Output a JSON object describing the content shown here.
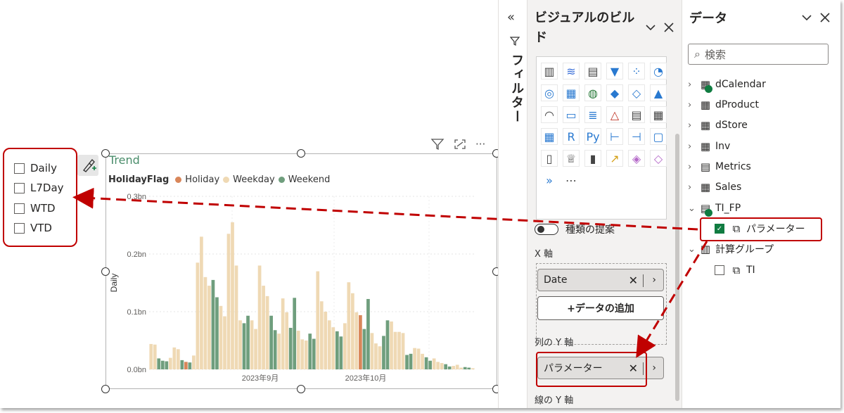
{
  "slicer": {
    "items": [
      {
        "label": "Daily",
        "checked": false
      },
      {
        "label": "L7Day",
        "checked": false
      },
      {
        "label": "WTD",
        "checked": false
      },
      {
        "label": "VTD",
        "checked": false
      }
    ]
  },
  "visual_header": {
    "filter_icon": "funnel-icon",
    "focus_icon": "expand-icon",
    "more_label": "···"
  },
  "chart_data": {
    "type": "bar",
    "title": "Trend",
    "legend_title": "HolidayFlag",
    "legend_position": "top-left",
    "series": [
      {
        "name": "Holiday",
        "color": "#d9865a"
      },
      {
        "name": "Weekday",
        "color": "#efd9b4"
      },
      {
        "name": "Weekend",
        "color": "#6f9e7d"
      }
    ],
    "ylabel": "Daily",
    "xlabel": "",
    "yticks": [
      "0.3bn",
      "0.2bn",
      "0.1bn",
      "0.0bn"
    ],
    "ylim": [
      0,
      0.3
    ],
    "xticks": [
      "2023年9月",
      "2023年10月"
    ],
    "grid": true,
    "values": [
      0.044,
      0.043,
      0.019,
      0.015,
      0.014,
      0.02,
      0.038,
      0.035,
      0.016,
      0.013,
      0.012,
      0.024,
      0.185,
      0.23,
      0.16,
      0.145,
      0.155,
      0.125,
      0.11,
      0.092,
      0.235,
      0.255,
      0.18,
      0.085,
      0.08,
      0.093,
      0.085,
      0.07,
      0.18,
      0.145,
      0.127,
      0.093,
      0.068,
      0.062,
      0.123,
      0.099,
      0.072,
      0.124,
      0.067,
      0.052,
      0.05,
      0.062,
      0.053,
      0.17,
      0.118,
      0.1,
      0.085,
      0.073,
      0.066,
      0.057,
      0.08,
      0.151,
      0.132,
      0.099,
      0.094,
      0.07,
      0.122,
      0.063,
      0.045,
      0.04,
      0.058,
      0.085,
      0.083,
      0.065,
      0.065,
      0.063,
      0.025,
      0.027,
      0.037,
      0.036,
      0.027,
      0.021,
      0.015,
      0.019,
      0.013,
      0.011,
      0.009,
      0.005,
      0.006,
      0.008,
      0.003,
      0.004,
      0.003,
      0.002
    ],
    "flags": [
      "D",
      "D",
      "W",
      "W",
      "W",
      "D",
      "D",
      "D",
      "W",
      "H",
      "W",
      "D",
      "D",
      "D",
      "D",
      "D",
      "W",
      "W",
      "D",
      "D",
      "D",
      "D",
      "D",
      "D",
      "W",
      "W",
      "D",
      "D",
      "D",
      "D",
      "D",
      "W",
      "W",
      "D",
      "D",
      "D",
      "W",
      "W",
      "D",
      "D",
      "D",
      "W",
      "W",
      "D",
      "D",
      "D",
      "D",
      "D",
      "W",
      "W",
      "D",
      "D",
      "D",
      "D",
      "H",
      "W",
      "W",
      "D",
      "D",
      "D",
      "W",
      "W",
      "D",
      "D",
      "D",
      "D",
      "W",
      "W",
      "D",
      "D",
      "D",
      "W",
      "W",
      "D",
      "D",
      "D",
      "W",
      "W",
      "D",
      "D",
      "D",
      "W",
      "W",
      "D"
    ]
  },
  "filter_pane": {
    "collapse_glyph": "«",
    "label": "フィルター"
  },
  "build_pane": {
    "title": "ビジュアルのビルド",
    "suggest_label": "種類の提案",
    "x_axis_label": "X 軸",
    "x_field": "Date",
    "add_data_label": "+データの追加",
    "col_y_label": "列の Y 軸",
    "col_y_field": "パラメーター",
    "line_y_label": "線の Y 軸"
  },
  "data_pane": {
    "title": "データ",
    "search_placeholder": "検索",
    "tables": [
      {
        "name": "dCalendar",
        "icon": "table-icon",
        "badge": true
      },
      {
        "name": "dProduct",
        "icon": "table-icon",
        "badge": false
      },
      {
        "name": "dStore",
        "icon": "table-icon",
        "badge": false
      },
      {
        "name": "Inv",
        "icon": "table-icon",
        "badge": false
      },
      {
        "name": "Metrics",
        "icon": "measure-table-icon",
        "badge": false
      },
      {
        "name": "Sales",
        "icon": "table-icon",
        "badge": false
      },
      {
        "name": "TI_FP",
        "icon": "param-table-icon",
        "badge": true
      },
      {
        "name": "パラメーター",
        "icon": "field-param-icon",
        "badge": false
      },
      {
        "name": "計算グループ",
        "icon": "calc-group-icon",
        "badge": false
      },
      {
        "name": "TI",
        "icon": "calc-item-icon",
        "badge": false
      }
    ]
  }
}
